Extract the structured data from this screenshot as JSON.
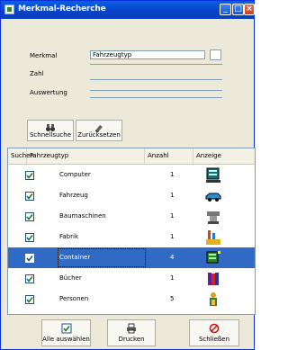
{
  "window": {
    "title": "Merkmal-Recherche"
  },
  "form": {
    "merkmal_label": "Merkmal",
    "merkmal_value": "Fahrzeugtyp",
    "zahl_label": "Zahl",
    "auswertung_label": "Auswertung"
  },
  "toolbar": {
    "search_label": "Schnellsuche",
    "clear_label": "Zurücksetzen"
  },
  "grid": {
    "columns": [
      "Suchen",
      "Fahrzeugtyp",
      "Anzahl",
      "Anzeige"
    ],
    "rows": [
      {
        "checked": true,
        "name": "Computer",
        "count": "1",
        "icon": "computer-icon",
        "selected": false
      },
      {
        "checked": true,
        "name": "Fahrzeug",
        "count": "1",
        "icon": "vehicle-icon",
        "selected": false
      },
      {
        "checked": true,
        "name": "Baumaschinen",
        "count": "1",
        "icon": "machine-icon",
        "selected": false
      },
      {
        "checked": true,
        "name": "Fabrik",
        "count": "1",
        "icon": "factory-icon",
        "selected": false
      },
      {
        "checked": true,
        "name": "Container",
        "count": "4",
        "icon": "container-icon",
        "selected": true
      },
      {
        "checked": true,
        "name": "Bücher",
        "count": "1",
        "icon": "books-icon",
        "selected": false
      },
      {
        "checked": true,
        "name": "Personen",
        "count": "5",
        "icon": "person-icon",
        "selected": false
      }
    ]
  },
  "footer": {
    "select_all_label": "Alle auswählen",
    "print_label": "Drucken",
    "close_label": "Schließen"
  },
  "colors": {
    "titlebar": "#0842c6",
    "selection": "#316ac5",
    "face": "#ece9d8"
  }
}
